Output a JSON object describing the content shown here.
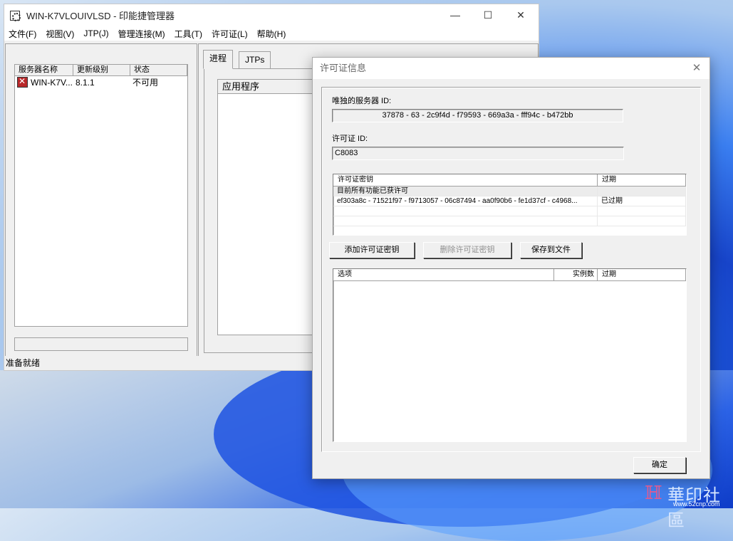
{
  "main_window": {
    "title": "WIN-K7VLOUIVLSD - 印能捷管理器",
    "controls": {
      "minimize": "—",
      "maximize": "☐",
      "close": "✕"
    },
    "menu": [
      "文件(F)",
      "视图(V)",
      "JTP(J)",
      "管理连接(M)",
      "工具(T)",
      "许可证(L)",
      "帮助(H)"
    ],
    "server_list": {
      "columns": [
        "服务器名称",
        "更新级别",
        "状态"
      ],
      "rows": [
        {
          "name": "WIN-K7V...",
          "version": "8.1.1",
          "status": "不可用"
        }
      ]
    },
    "tabs": [
      "进程",
      "JTPs"
    ],
    "app_list_header": "应用程序",
    "status_text": "准备就绪"
  },
  "license_dialog": {
    "title": "许可证信息",
    "close": "✕",
    "server_id_label": "唯独的服务器 ID:",
    "server_id_value": "37878 - 63 - 2c9f4d - f79593 - 669a3a - fff94c - b472bb",
    "license_id_label": "许可证 ID:",
    "license_id_value": "C8083",
    "keys_table": {
      "columns": [
        "许可证密钥",
        "过期"
      ],
      "rows": [
        {
          "key": "目前所有功能已获许可",
          "expiry": ""
        },
        {
          "key": "ef303a8c - 71521f97 - f9713057 - 06c87494 - aa0f90b6 - fe1d37cf - c4968...",
          "expiry": "已过期"
        }
      ]
    },
    "buttons": {
      "add": "添加许可证密钥",
      "remove": "删除许可证密钥",
      "save": "保存到文件",
      "ok": "确定"
    },
    "options_table": {
      "columns": [
        "选项",
        "实例数",
        "过期"
      ]
    }
  },
  "watermark": {
    "logo": "ℍ",
    "text": "華印社區",
    "url": "www.52cnp.com"
  }
}
